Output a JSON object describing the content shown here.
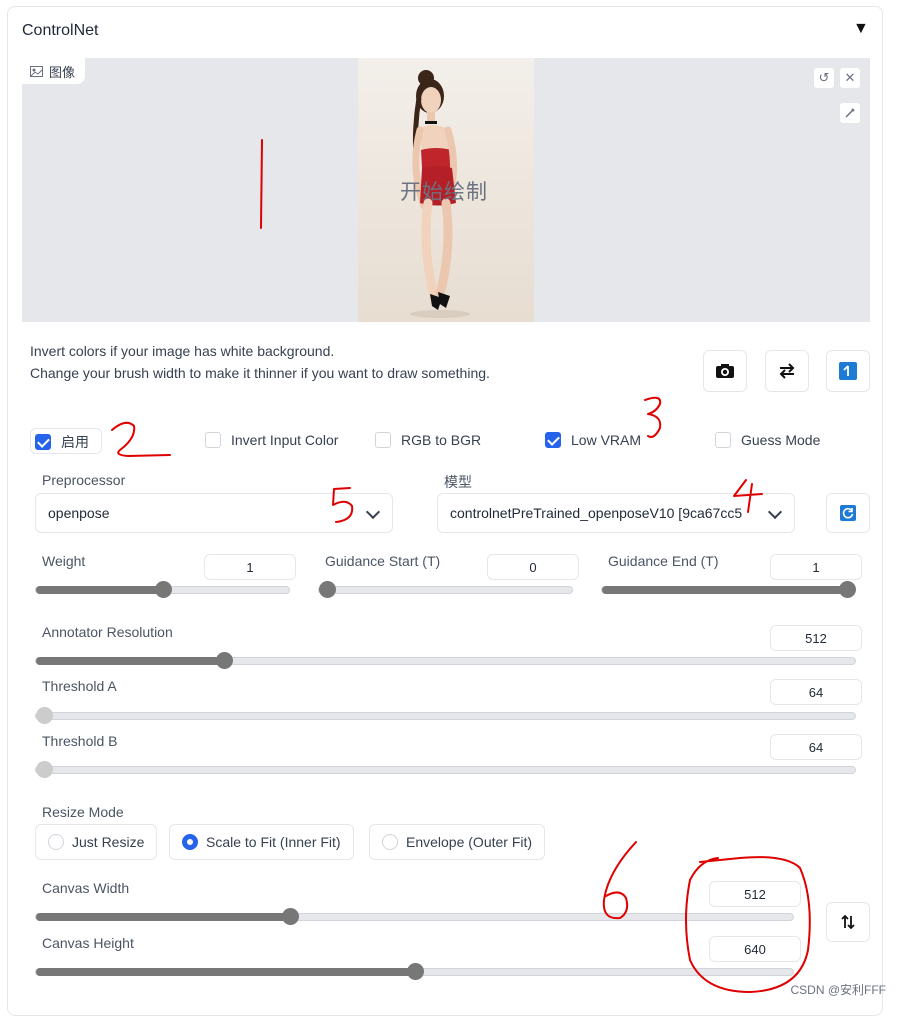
{
  "header": {
    "title": "ControlNet",
    "collapse_icon": "▼"
  },
  "image_panel": {
    "tag_label": "图像",
    "draw_prompt": "开始绘制",
    "buttons": [
      "undo-icon",
      "close-icon",
      "brush-icon"
    ]
  },
  "hints": {
    "line1": "Invert colors if your image has white background.",
    "line2": "Change your brush width to make it thinner if you want to draw something."
  },
  "tools": [
    "camera-icon",
    "swap-icon",
    "upload-icon"
  ],
  "checkboxes": {
    "enable": {
      "label": "启用",
      "checked": true
    },
    "invert": {
      "label": "Invert Input Color",
      "checked": false
    },
    "rgb_bgr": {
      "label": "RGB to BGR",
      "checked": false
    },
    "low_vram": {
      "label": "Low VRAM",
      "checked": true
    },
    "guess": {
      "label": "Guess Mode",
      "checked": false
    }
  },
  "preprocessor": {
    "label": "Preprocessor",
    "value": "openpose"
  },
  "model": {
    "label": "模型",
    "value": "controlnetPreTrained_openposeV10 [9ca67cc5"
  },
  "sliders": {
    "weight": {
      "label": "Weight",
      "value": "1",
      "fraction": 0.5
    },
    "guidance_start": {
      "label": "Guidance Start (T)",
      "value": "0",
      "fraction": 0.0
    },
    "guidance_end": {
      "label": "Guidance End (T)",
      "value": "1",
      "fraction": 1.0
    },
    "annotator_resolution": {
      "label": "Annotator Resolution",
      "value": "512",
      "fraction": 0.23
    },
    "threshold_a": {
      "label": "Threshold A",
      "value": "64",
      "fraction": 0.0
    },
    "threshold_b": {
      "label": "Threshold B",
      "value": "64",
      "fraction": 0.0
    },
    "canvas_width": {
      "label": "Canvas Width",
      "value": "512",
      "fraction": 0.335
    },
    "canvas_height": {
      "label": "Canvas Height",
      "value": "640",
      "fraction": 0.5
    }
  },
  "resize_mode": {
    "label": "Resize Mode",
    "options": [
      "Just Resize",
      "Scale to Fit (Inner Fit)",
      "Envelope (Outer Fit)"
    ],
    "selected": "Scale to Fit (Inner Fit)"
  },
  "annotations": {
    "n1": "1",
    "n2": "2",
    "n3": "3",
    "n4": "4",
    "n5": "5",
    "n6": "6"
  },
  "watermark": "CSDN @安利FFF",
  "colors": {
    "accent": "#2563eb",
    "annotation": "#e00000",
    "slider": "#777777"
  }
}
